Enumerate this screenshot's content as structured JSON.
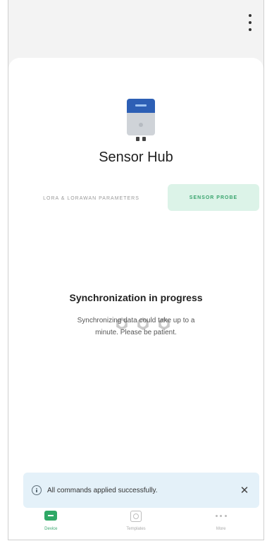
{
  "header": {
    "menu_icon": "more-vertical-icon"
  },
  "device": {
    "name": "Sensor Hub",
    "image_icon": "device-image",
    "colors": {
      "top": "#2d5fb5",
      "body": "#cfd3d8"
    }
  },
  "tabs": [
    {
      "label": "LORA & LORAWAN PARAMETERS",
      "active": false
    },
    {
      "label": "SENSOR PROBE",
      "active": true
    }
  ],
  "sync": {
    "loader_icon": "gear-loader-icon",
    "title": "Synchronization in progress",
    "message": "Synchronizing data could take up to a minute. Please be patient."
  },
  "toast": {
    "icon": "info-icon",
    "message": "All commands applied successfully.",
    "close_icon": "close-icon",
    "background": "#e4f1f9"
  },
  "bottom_nav": [
    {
      "label": "Device",
      "icon": "device-icon",
      "active": true
    },
    {
      "label": "Templates",
      "icon": "templates-icon",
      "active": false
    },
    {
      "label": "More",
      "icon": "more-horizontal-icon",
      "active": false
    }
  ],
  "colors": {
    "accent": "#3aa56e",
    "accent_bg": "#dcf3e8"
  }
}
